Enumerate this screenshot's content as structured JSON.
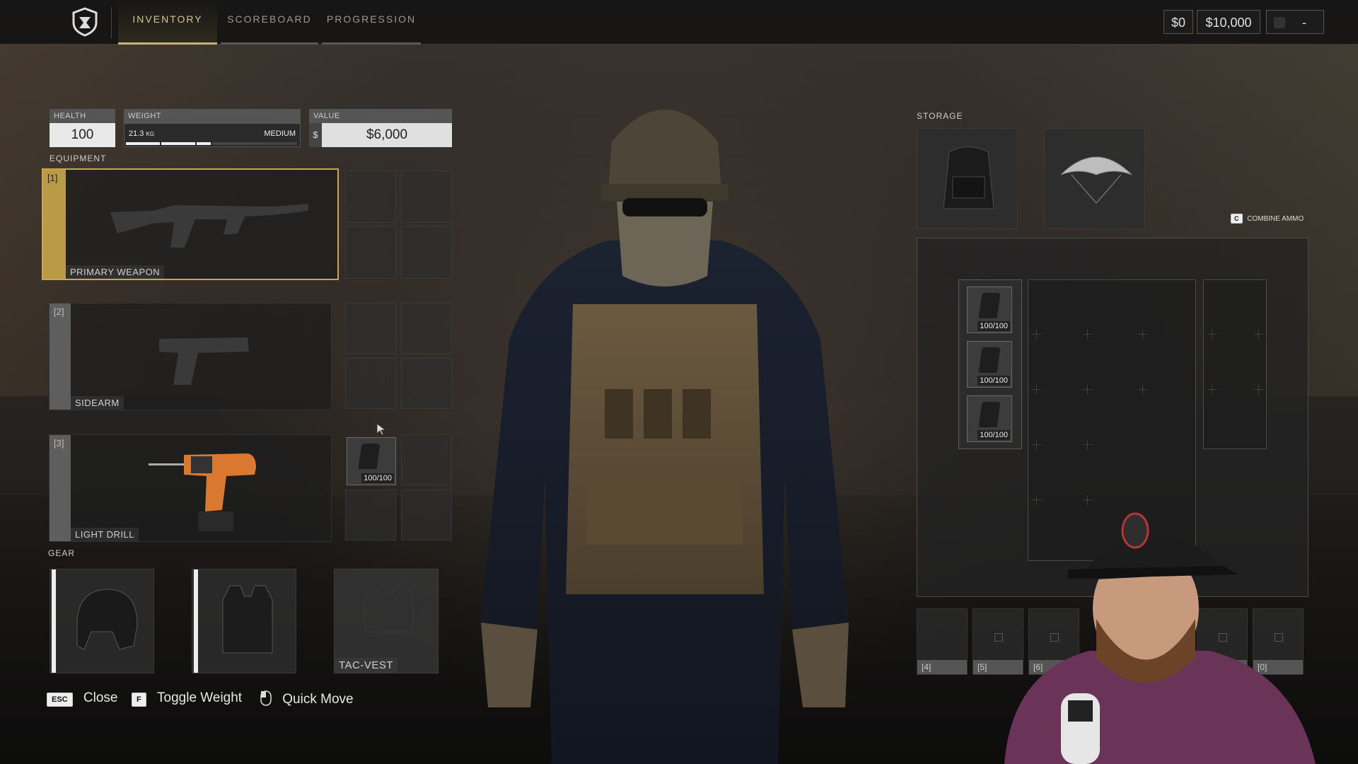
{
  "nav": {
    "tabs": [
      {
        "label": "INVENTORY",
        "active": true
      },
      {
        "label": "SCOREBOARD",
        "active": false
      },
      {
        "label": "PROGRESSION",
        "active": false
      }
    ]
  },
  "currency": {
    "cash": "$0",
    "bank": "$10,000",
    "extra": "-"
  },
  "stats": {
    "health_label": "HEALTH",
    "health_value": "100",
    "weight_label": "WEIGHT",
    "weight_value": "21.3",
    "weight_unit": "KG",
    "weight_class": "MEDIUM",
    "value_label": "VALUE",
    "value_symbol": "$",
    "value_amount": "$6,000"
  },
  "equipment": {
    "section_label": "EQUIPMENT",
    "slots": [
      {
        "number": "[1]",
        "label": "PRIMARY WEAPON"
      },
      {
        "number": "[2]",
        "label": "SIDEARM"
      },
      {
        "number": "[3]",
        "label": "LIGHT DRILL"
      }
    ],
    "drill_ammo": "100/100"
  },
  "gear": {
    "section_label": "GEAR",
    "vest_label": "TAC-VEST"
  },
  "storage": {
    "section_label": "STORAGE",
    "combine_key": "C",
    "combine_label": "COMBINE AMMO",
    "mags": [
      "100/100",
      "100/100",
      "100/100"
    ],
    "quick_slots": [
      "[4]",
      "[5]",
      "[6]",
      "",
      "[0]"
    ]
  },
  "hints": {
    "close_key": "ESC",
    "close_label": "Close",
    "weight_key": "F",
    "weight_label": "Toggle Weight",
    "move_label": "Quick Move"
  },
  "colors": {
    "accent": "#c9b27a",
    "selected_slot": "#c9a74a"
  }
}
